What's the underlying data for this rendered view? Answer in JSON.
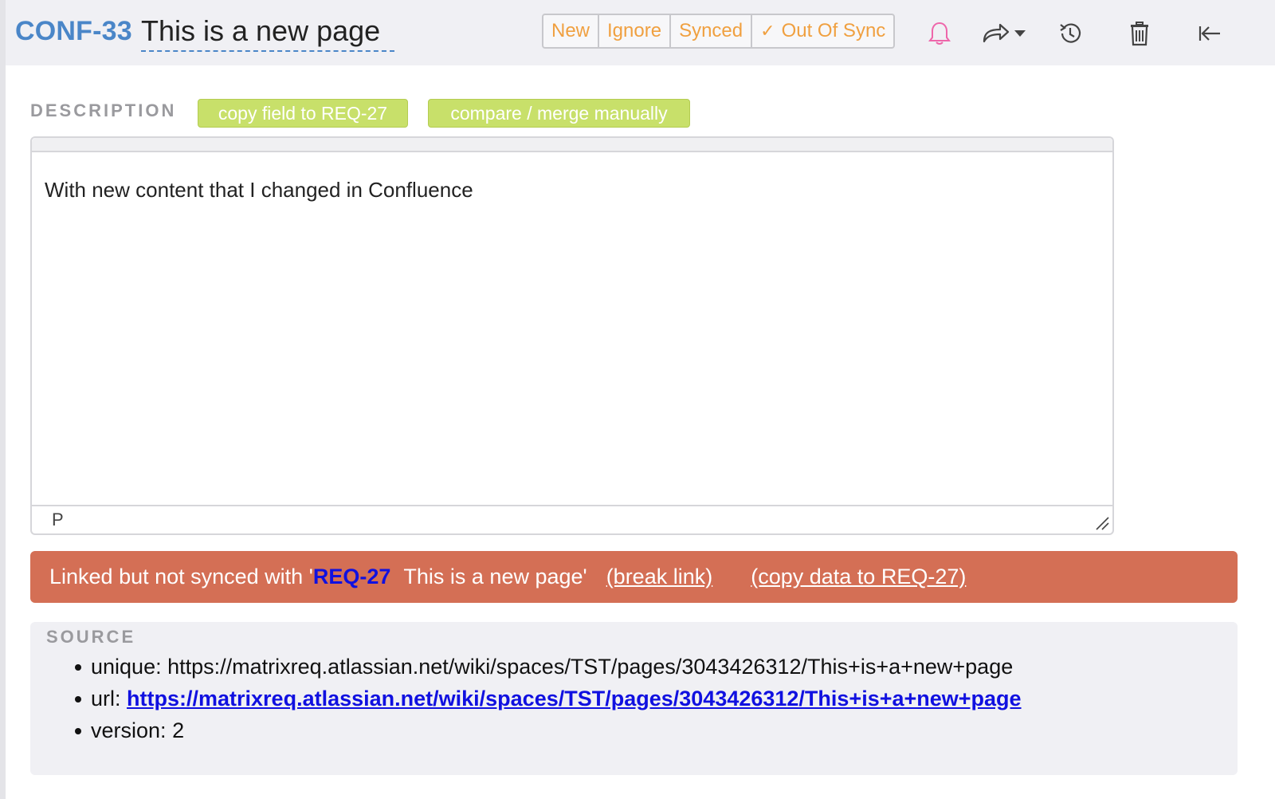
{
  "header": {
    "item_id": "CONF-33",
    "title": "This is a new page",
    "status_buttons": [
      {
        "label": "New"
      },
      {
        "label": "Ignore"
      },
      {
        "label": "Synced"
      },
      {
        "label": "Out Of Sync",
        "checked": true
      }
    ],
    "icons": [
      "bell-icon",
      "share-icon",
      "history-icon",
      "trash-icon",
      "collapse-icon"
    ]
  },
  "description": {
    "label": "DESCRIPTION",
    "copy_button": "copy field to REQ-27",
    "compare_button": "compare / merge manually",
    "content": "With new content that I changed in Confluence",
    "element_path": "P"
  },
  "banner": {
    "prefix": "Linked but not synced with '",
    "req_id": "REQ-27",
    "req_title": "This is a new page'",
    "break_link": "(break link)",
    "copy_link": "(copy data to REQ-27)"
  },
  "source": {
    "label": "SOURCE",
    "unique_label": "unique:",
    "unique_value": "https://matrixreq.atlassian.net/wiki/spaces/TST/pages/3043426312/This+is+a+new+page",
    "url_label": "url:",
    "url_value": "https://matrixreq.atlassian.net/wiki/spaces/TST/pages/3043426312/This+is+a+new+page",
    "version_label": "version:",
    "version_value": "2"
  },
  "colors": {
    "accent": "#4a86c8",
    "status_orange": "#f0a040",
    "green_button": "#c8e06a",
    "banner_red": "#d46f55",
    "link_blue": "#1010e0",
    "bell_pink": "#ee66aa"
  }
}
